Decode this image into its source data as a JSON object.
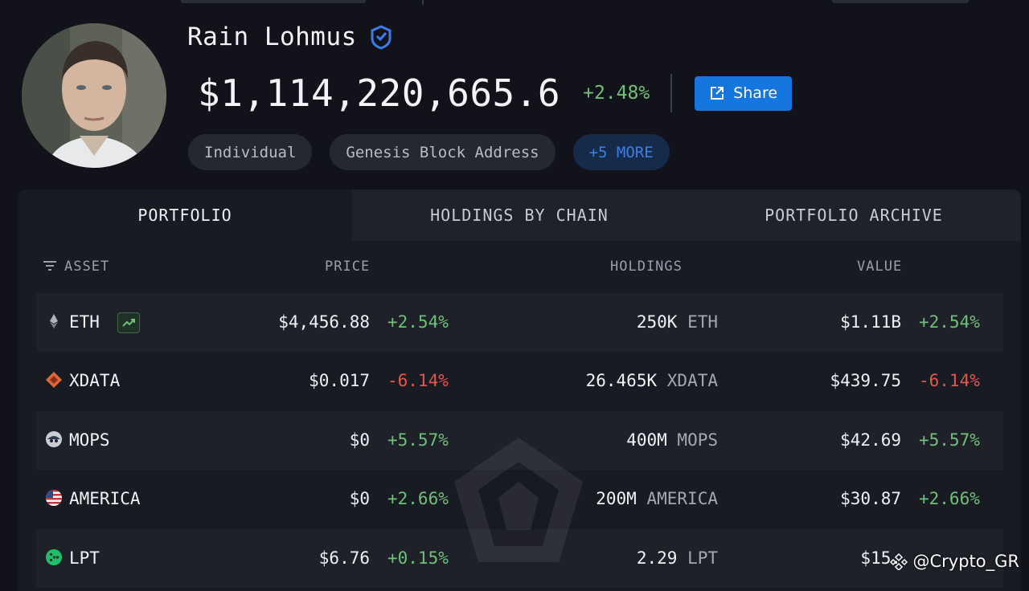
{
  "profile": {
    "name": "Rain Lohmus",
    "balance": "$1,114,220,665.6",
    "change": "+2.48%",
    "share_label": "Share",
    "tags": [
      "Individual",
      "Genesis Block Address"
    ],
    "more_label": "+5 MORE"
  },
  "tabs": [
    "PORTFOLIO",
    "HOLDINGS BY CHAIN",
    "PORTFOLIO ARCHIVE"
  ],
  "table": {
    "headers": {
      "asset": "ASSET",
      "price": "PRICE",
      "holdings": "HOLDINGS",
      "value": "VALUE"
    },
    "rows": [
      {
        "symbol": "ETH",
        "icon": "eth-icon",
        "price": "$4,456.88",
        "price_change": "+2.54%",
        "holdings": "250K",
        "unit": "ETH",
        "value": "$1.11B",
        "value_change": "+2.54%",
        "trend": "up"
      },
      {
        "symbol": "XDATA",
        "icon": "xdata-icon",
        "price": "$0.017",
        "price_change": "-6.14%",
        "holdings": "26.465K",
        "unit": "XDATA",
        "value": "$439.75",
        "value_change": "-6.14%",
        "trend": "down"
      },
      {
        "symbol": "MOPS",
        "icon": "mops-icon",
        "price": "$0",
        "price_change": "+5.57%",
        "holdings": "400M",
        "unit": "MOPS",
        "value": "$42.69",
        "value_change": "+5.57%",
        "trend": "up"
      },
      {
        "symbol": "AMERICA",
        "icon": "us-flag-icon",
        "price": "$0",
        "price_change": "+2.66%",
        "holdings": "200M",
        "unit": "AMERICA",
        "value": "$30.87",
        "value_change": "+2.66%",
        "trend": "up"
      },
      {
        "symbol": "LPT",
        "icon": "lpt-icon",
        "price": "$6.76",
        "price_change": "+0.15%",
        "holdings": "2.29",
        "unit": "LPT",
        "value": "$15.",
        "value_change": "",
        "trend": "up"
      }
    ]
  },
  "credit": "@Crypto_GR",
  "colors": {
    "positive": "#6ec07a",
    "negative": "#e0574c",
    "accent": "#1676e0"
  }
}
